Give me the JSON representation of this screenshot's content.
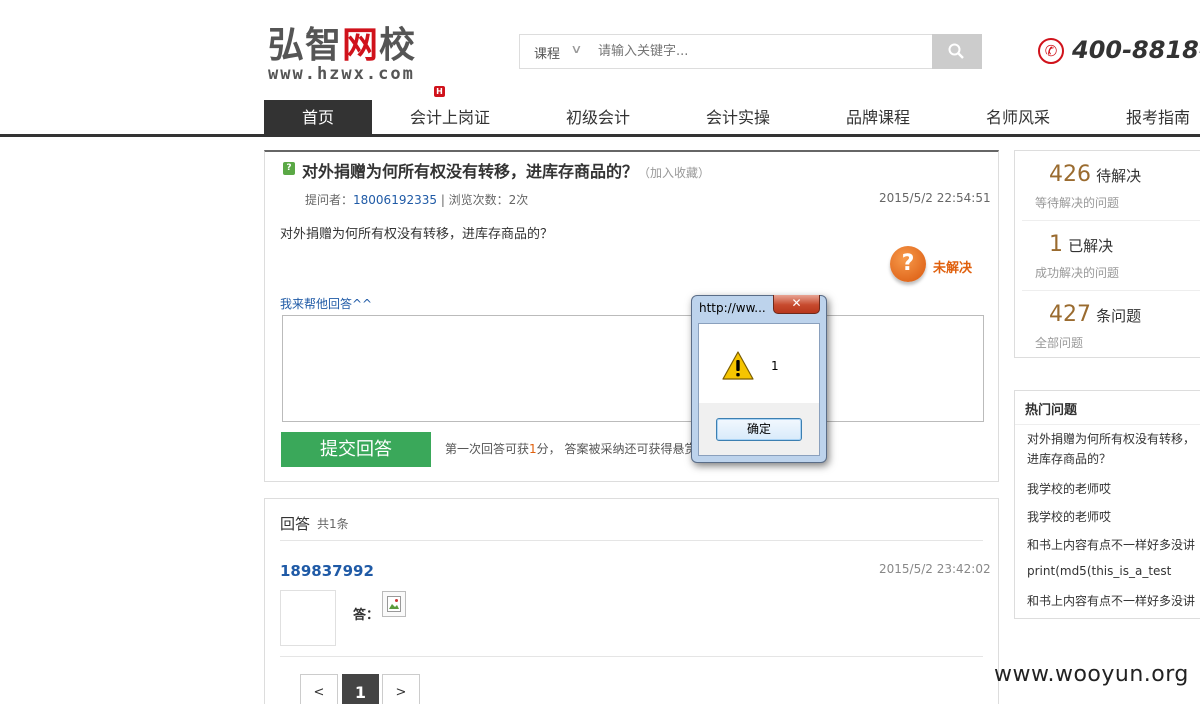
{
  "header": {
    "logo_text_1": "弘智",
    "logo_text_2": "网",
    "logo_text_3": "校",
    "logo_url": "www.hzwx.com",
    "logo_badge": "H",
    "search": {
      "category": "课程",
      "placeholder": "请输入关键字..."
    },
    "phone": "400-8818-"
  },
  "nav": {
    "items": [
      {
        "label": "首页"
      },
      {
        "label": "会计上岗证"
      },
      {
        "label": "初级会计"
      },
      {
        "label": "会计实操"
      },
      {
        "label": "品牌课程"
      },
      {
        "label": "名师风采"
      },
      {
        "label": "报考指南"
      }
    ]
  },
  "question": {
    "title": "对外捐赠为何所有权没有转移，进库存商品的？",
    "add_favorite": "（加入收藏）",
    "asker_label": "提问者：",
    "asker": "18006192335",
    "views": " | 浏览次数：2次",
    "date": "2015/5/2 22:54:51",
    "body": "对外捐赠为何所有权没有转移，进库存商品的？",
    "status_icon": "?",
    "status": "未解决",
    "help_label": "我来帮他回答^^",
    "submit_label": "提交回答",
    "submit_note_1": "第一次回答可获",
    "submit_note_num": "1",
    "submit_note_2": "分， 答案被采纳还可获得悬赏"
  },
  "answers": {
    "title": "回答",
    "count": "共1条",
    "items": [
      {
        "user": "189837992",
        "date": "2015/5/2 23:42:02",
        "label": "答："
      }
    ],
    "pager": {
      "prev": "<",
      "current": "1",
      "next": ">"
    }
  },
  "sidebar": {
    "stats": [
      {
        "num": "426",
        "unit": "待解决",
        "sub": "等待解决的问题"
      },
      {
        "num": "1",
        "unit": "已解决",
        "sub": "成功解决的问题"
      },
      {
        "num": "427",
        "unit": "条问题",
        "sub": "全部问题"
      }
    ],
    "hot_title": "热门问题",
    "hot_items": [
      "对外捐赠为何所有权没有转移，进库存商品的？",
      "我学校的老师哎",
      "我学校的老师哎",
      "和书上内容有点不一样好多没讲",
      "print(md5(this_is_a_test",
      "和书上内容有点不一样好多没讲"
    ]
  },
  "dialog": {
    "title": "http://ww...",
    "close": "✕",
    "message": "1",
    "ok_label": "确定"
  },
  "watermark": "www.wooyun.org",
  "colors": {
    "accent_green": "#3aa85a",
    "link_blue": "#1f5aa6",
    "brand_red": "#d0121b",
    "status_orange": "#e0600d"
  }
}
